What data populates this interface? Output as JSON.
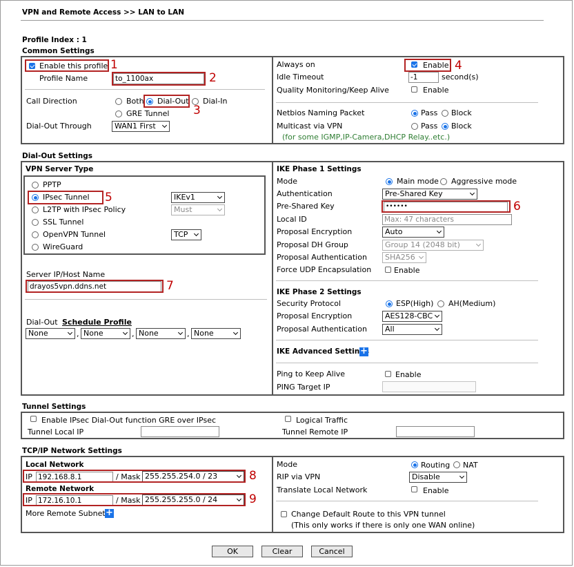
{
  "breadcrumb": "VPN and Remote Access >> LAN to LAN",
  "profile_index": "Profile Index : 1",
  "common": {
    "title": "Common Settings",
    "enable_profile": "Enable this profile",
    "profile_name_label": "Profile Name",
    "profile_name_value": "to_1100ax",
    "call_direction_label": "Call Direction",
    "call_both": "Both",
    "call_dialout": "Dial-Out",
    "call_dialin": "Dial-In",
    "call_gre": "GRE Tunnel",
    "dialout_through_label": "Dial-Out Through",
    "dialout_through_value": "WAN1 First",
    "always_on_label": "Always on",
    "always_on_enable": "Enable",
    "idle_timeout_label": "Idle Timeout",
    "idle_timeout_value": "-1",
    "idle_timeout_unit": "second(s)",
    "quality_label": "Quality Monitoring/Keep Alive",
    "quality_enable": "Enable",
    "netbios_label": "Netbios Naming Packet",
    "netbios_pass": "Pass",
    "netbios_block": "Block",
    "multicast_label": "Multicast via VPN",
    "multicast_pass": "Pass",
    "multicast_block": "Block",
    "multicast_note": "(for some IGMP,IP-Camera,DHCP Relay..etc.)"
  },
  "dialout": {
    "title": "Dial-Out Settings",
    "vpn_server_type": "VPN Server Type",
    "types": [
      "PPTP",
      "IPsec Tunnel",
      "L2TP with IPsec Policy",
      "SSL Tunnel",
      "OpenVPN Tunnel",
      "WireGuard"
    ],
    "ipsec_select": "IKEv1",
    "l2tp_select": "Must",
    "openvpn_select": "TCP",
    "server_label": "Server IP/Host Name",
    "server_value": "drayos5vpn.ddns.net",
    "dialout_label": "Dial-Out",
    "schedule_label": "Schedule Profile",
    "schedules": [
      "None",
      "None",
      "None",
      "None"
    ],
    "ike1_title": "IKE Phase 1 Settings",
    "mode_label": "Mode",
    "mode_main": "Main mode",
    "mode_aggressive": "Aggressive mode",
    "auth_label": "Authentication",
    "auth_value": "Pre-Shared Key",
    "psk_label": "Pre-Shared Key",
    "psk_value": "••••••",
    "local_id_label": "Local ID",
    "local_id_placeholder": "Max: 47 characters",
    "p1_enc_label": "Proposal Encryption",
    "p1_enc_value": "Auto",
    "p1_dh_label": "Proposal DH Group",
    "p1_dh_value": "Group 14 (2048 bit)",
    "p1_auth_label": "Proposal Authentication",
    "p1_auth_value": "SHA256",
    "force_udp_label": "Force UDP Encapsulation",
    "force_udp_enable": "Enable",
    "ike2_title": "IKE Phase 2 Settings",
    "sec_proto_label": "Security Protocol",
    "sec_esp": "ESP(High)",
    "sec_ah": "AH(Medium)",
    "p2_enc_label": "Proposal Encryption",
    "p2_enc_value": "AES128-CBC",
    "p2_auth_label": "Proposal Authentication",
    "p2_auth_value": "All",
    "ike_adv_label": "IKE Advanced Settings",
    "ping_label": "Ping to Keep Alive",
    "ping_enable": "Enable",
    "ping_target_label": "PING Target IP"
  },
  "tunnel": {
    "title": "Tunnel Settings",
    "gre_label": "Enable IPsec Dial-Out function GRE over IPsec",
    "logical_label": "Logical Traffic",
    "local_ip_label": "Tunnel Local IP",
    "remote_ip_label": "Tunnel Remote IP"
  },
  "tcpip": {
    "title": "TCP/IP Network Settings",
    "local_network": "Local Network",
    "local_ip_prefix": "IP",
    "local_ip": "192.168.8.1",
    "local_mask_label": "/ Mask",
    "local_mask": "255.255.254.0 / 23",
    "remote_network": "Remote Network",
    "remote_ip_prefix": "IP",
    "remote_ip": "172.16.10.1",
    "remote_mask_label": "/ Mask",
    "remote_mask": "255.255.255.0 / 24",
    "more_subnet": "More Remote Subnet",
    "mode_label": "Mode",
    "mode_routing": "Routing",
    "mode_nat": "NAT",
    "rip_label": "RIP via VPN",
    "rip_value": "Disable",
    "translate_label": "Translate Local Network",
    "translate_enable": "Enable",
    "change_route": "Change Default Route to this VPN tunnel",
    "change_route_note": "(This only works if there is only one WAN online)"
  },
  "annotations": [
    "1",
    "2",
    "3",
    "4",
    "5",
    "6",
    "7",
    "8",
    "9"
  ],
  "buttons": {
    "ok": "OK",
    "clear": "Clear",
    "cancel": "Cancel"
  }
}
